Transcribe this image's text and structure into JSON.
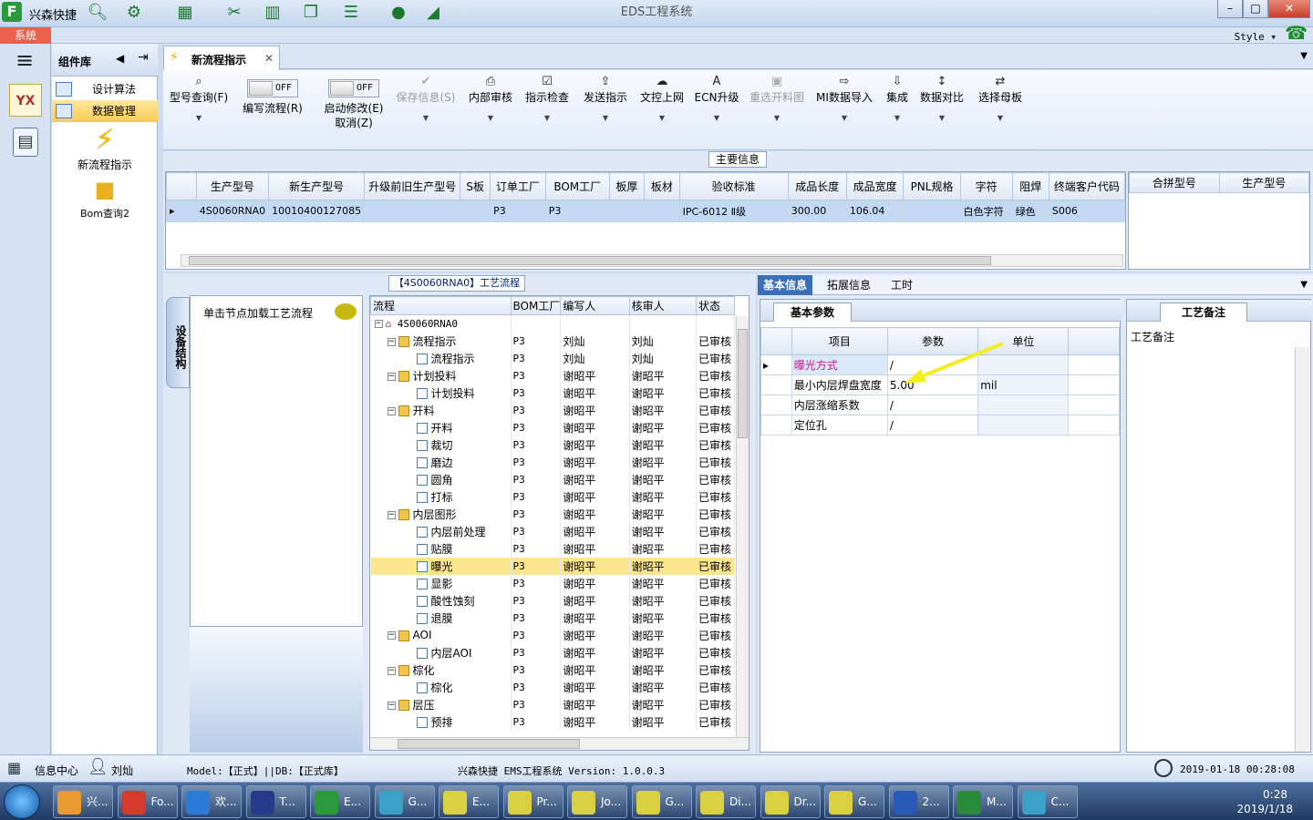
{
  "app": {
    "logo": "F",
    "title": "兴森快捷",
    "window_title": "EDS工程系统",
    "system_tab": "系统",
    "style_label": "Style",
    "quick_icons": [
      "search-icon",
      "settings-wheel-icon",
      "grid-icon",
      "scissors-icon",
      "film-icon",
      "copy-icon",
      "list-icon",
      "user-icon",
      "chart-icon"
    ]
  },
  "sidebar": {
    "comp_lib_title": "组件库",
    "items": [
      {
        "label": "设计算法"
      },
      {
        "label": "数据管理"
      }
    ],
    "big_items": [
      {
        "label": "新流程指示"
      },
      {
        "label": "Bom查询2"
      }
    ]
  },
  "doc_tab": {
    "label": "新流程指示"
  },
  "toolbar": {
    "buttons": [
      {
        "label": "型号查询(F)",
        "icon": "search-icon",
        "disabled": false
      },
      {
        "label": "编写流程(R)",
        "toggle": "OFF",
        "disabled": false
      },
      {
        "label": "启动修改(E)",
        "label2": "取消(Z)",
        "toggle": "OFF",
        "disabled": false
      },
      {
        "label": "保存信息(S)",
        "icon": "check-icon",
        "disabled": true
      },
      {
        "label": "内部审核",
        "icon": "printer-icon",
        "disabled": false
      },
      {
        "label": "指示检查",
        "icon": "checkbox-icon",
        "disabled": false
      },
      {
        "label": "发送指示",
        "icon": "upload-icon",
        "disabled": false
      },
      {
        "label": "文控上网",
        "icon": "cloud-icon",
        "disabled": false
      },
      {
        "label": "ECN升级",
        "icon": "letter-a-icon",
        "disabled": false
      },
      {
        "label": "重选开料图",
        "icon": "image-icon",
        "disabled": true
      },
      {
        "label": "MI数据导入",
        "icon": "import-icon",
        "disabled": false
      },
      {
        "label": "集成",
        "icon": "download-icon",
        "disabled": false
      },
      {
        "label": "数据对比",
        "icon": "compare-icon",
        "disabled": false
      },
      {
        "label": "选择母板",
        "icon": "shuffle-icon",
        "disabled": false
      }
    ]
  },
  "main_info": {
    "title": "主要信息",
    "columns": [
      "生产型号",
      "新生产型号",
      "升级前旧生产型号",
      "S板",
      "订单工厂",
      "BOM工厂",
      "板厚",
      "板材",
      "验收标准",
      "成品长度",
      "成品宽度",
      "PNL规格",
      "字符",
      "阻焊",
      "终端客户代码"
    ],
    "row": [
      "4S0060RNA0",
      "10010400127085",
      "",
      "",
      "P3",
      "P3",
      "",
      "",
      "IPC-6012 Ⅱ级",
      "300.00",
      "106.04",
      "",
      "白色字符",
      "绿色",
      "S006"
    ],
    "side_columns": [
      "合拼型号",
      "生产型号"
    ]
  },
  "process": {
    "title": "【4S0060RNA0】工艺流程",
    "device_tab": "设备结构",
    "click_hint": "单击节点加载工艺流程",
    "columns": [
      "流程",
      "BOM工厂",
      "编写人",
      "核审人",
      "状态"
    ],
    "root": "4S0060RNA0",
    "rows": [
      {
        "name": "流程指示",
        "level": 1,
        "folder": true,
        "bom": "P3",
        "writer": "刘灿",
        "reviewer": "刘灿",
        "status": "已审核"
      },
      {
        "name": "流程指示",
        "level": 2,
        "folder": false,
        "bom": "P3",
        "writer": "刘灿",
        "reviewer": "刘灿",
        "status": "已审核"
      },
      {
        "name": "计划投料",
        "level": 1,
        "folder": true,
        "bom": "P3",
        "writer": "谢昭平",
        "reviewer": "谢昭平",
        "status": "已审核"
      },
      {
        "name": "计划投料",
        "level": 2,
        "folder": false,
        "bom": "P3",
        "writer": "谢昭平",
        "reviewer": "谢昭平",
        "status": "已审核"
      },
      {
        "name": "开料",
        "level": 1,
        "folder": true,
        "bom": "P3",
        "writer": "谢昭平",
        "reviewer": "谢昭平",
        "status": "已审核"
      },
      {
        "name": "开料",
        "level": 2,
        "folder": false,
        "bom": "P3",
        "writer": "谢昭平",
        "reviewer": "谢昭平",
        "status": "已审核"
      },
      {
        "name": "裁切",
        "level": 2,
        "folder": false,
        "bom": "P3",
        "writer": "谢昭平",
        "reviewer": "谢昭平",
        "status": "已审核"
      },
      {
        "name": "磨边",
        "level": 2,
        "folder": false,
        "bom": "P3",
        "writer": "谢昭平",
        "reviewer": "谢昭平",
        "status": "已审核"
      },
      {
        "name": "圆角",
        "level": 2,
        "folder": false,
        "bom": "P3",
        "writer": "谢昭平",
        "reviewer": "谢昭平",
        "status": "已审核"
      },
      {
        "name": "打标",
        "level": 2,
        "folder": false,
        "bom": "P3",
        "writer": "谢昭平",
        "reviewer": "谢昭平",
        "status": "已审核"
      },
      {
        "name": "内层图形",
        "level": 1,
        "folder": true,
        "bom": "P3",
        "writer": "谢昭平",
        "reviewer": "谢昭平",
        "status": "已审核"
      },
      {
        "name": "内层前处理",
        "level": 2,
        "folder": false,
        "bom": "P3",
        "writer": "谢昭平",
        "reviewer": "谢昭平",
        "status": "已审核"
      },
      {
        "name": "贴膜",
        "level": 2,
        "folder": false,
        "bom": "P3",
        "writer": "谢昭平",
        "reviewer": "谢昭平",
        "status": "已审核"
      },
      {
        "name": "曝光",
        "level": 2,
        "folder": false,
        "bom": "P3",
        "writer": "谢昭平",
        "reviewer": "谢昭平",
        "status": "已审核",
        "highlight": true
      },
      {
        "name": "显影",
        "level": 2,
        "folder": false,
        "bom": "P3",
        "writer": "谢昭平",
        "reviewer": "谢昭平",
        "status": "已审核"
      },
      {
        "name": "酸性蚀刻",
        "level": 2,
        "folder": false,
        "bom": "P3",
        "writer": "谢昭平",
        "reviewer": "谢昭平",
        "status": "已审核"
      },
      {
        "name": "退膜",
        "level": 2,
        "folder": false,
        "bom": "P3",
        "writer": "谢昭平",
        "reviewer": "谢昭平",
        "status": "已审核"
      },
      {
        "name": "AOI",
        "level": 1,
        "folder": true,
        "bom": "P3",
        "writer": "谢昭平",
        "reviewer": "谢昭平",
        "status": "已审核"
      },
      {
        "name": "内层AOI",
        "level": 2,
        "folder": false,
        "bom": "P3",
        "writer": "谢昭平",
        "reviewer": "谢昭平",
        "status": "已审核"
      },
      {
        "name": "棕化",
        "level": 1,
        "folder": true,
        "bom": "P3",
        "writer": "谢昭平",
        "reviewer": "谢昭平",
        "status": "已审核"
      },
      {
        "name": "棕化",
        "level": 2,
        "folder": false,
        "bom": "P3",
        "writer": "谢昭平",
        "reviewer": "谢昭平",
        "status": "已审核"
      },
      {
        "name": "层压",
        "level": 1,
        "folder": true,
        "bom": "P3",
        "writer": "谢昭平",
        "reviewer": "谢昭平",
        "status": "已审核"
      },
      {
        "name": "预排",
        "level": 2,
        "folder": false,
        "bom": "P3",
        "writer": "谢昭平",
        "reviewer": "谢昭平",
        "status": "已审核"
      }
    ]
  },
  "right_tabs": [
    "基本信息",
    "拓展信息",
    "工时"
  ],
  "basic_params": {
    "tab": "基本参数",
    "columns": [
      "项目",
      "参数",
      "单位"
    ],
    "rows": [
      {
        "item": "曝光方式",
        "value": "/",
        "unit": "",
        "highlight": true
      },
      {
        "item": "最小内层焊盘宽度",
        "value": "5.00",
        "unit": "mil"
      },
      {
        "item": "内层涨缩系数",
        "value": "/",
        "unit": ""
      },
      {
        "item": "定位孔",
        "value": "/",
        "unit": ""
      }
    ]
  },
  "memo": {
    "tab": "工艺备注",
    "label": "工艺备注"
  },
  "status": {
    "info_center": "信息中心",
    "user": "刘灿",
    "model": "Model:【正式】||DB:【正式库】",
    "version": "兴森快捷  EMS工程系统  Version: 1.0.0.3",
    "datetime": "2019-01-18 00:28:08"
  },
  "taskbar": {
    "tasks": [
      {
        "label": "兴...",
        "color": "#e89a2c"
      },
      {
        "label": "Fo...",
        "color": "#d63a2a"
      },
      {
        "label": "欢...",
        "color": "#2a7ad6"
      },
      {
        "label": "T...",
        "color": "#2a3a8a"
      },
      {
        "label": "E...",
        "color": "#2a9a3c"
      },
      {
        "label": "G...",
        "color": "#3aa0c8"
      },
      {
        "label": "E...",
        "color": "#d8d040"
      },
      {
        "label": "Pr...",
        "color": "#d8d040"
      },
      {
        "label": "Jo...",
        "color": "#d8d040"
      },
      {
        "label": "G...",
        "color": "#d8d040"
      },
      {
        "label": "Di...",
        "color": "#d8d040"
      },
      {
        "label": "Dr...",
        "color": "#d8d040"
      },
      {
        "label": "G...",
        "color": "#d8d040"
      },
      {
        "label": "2...",
        "color": "#2a5ab8"
      },
      {
        "label": "M...",
        "color": "#2a8a3c"
      },
      {
        "label": "C...",
        "color": "#3aa0c8"
      }
    ],
    "time": "0:28",
    "date": "2019/1/18"
  }
}
